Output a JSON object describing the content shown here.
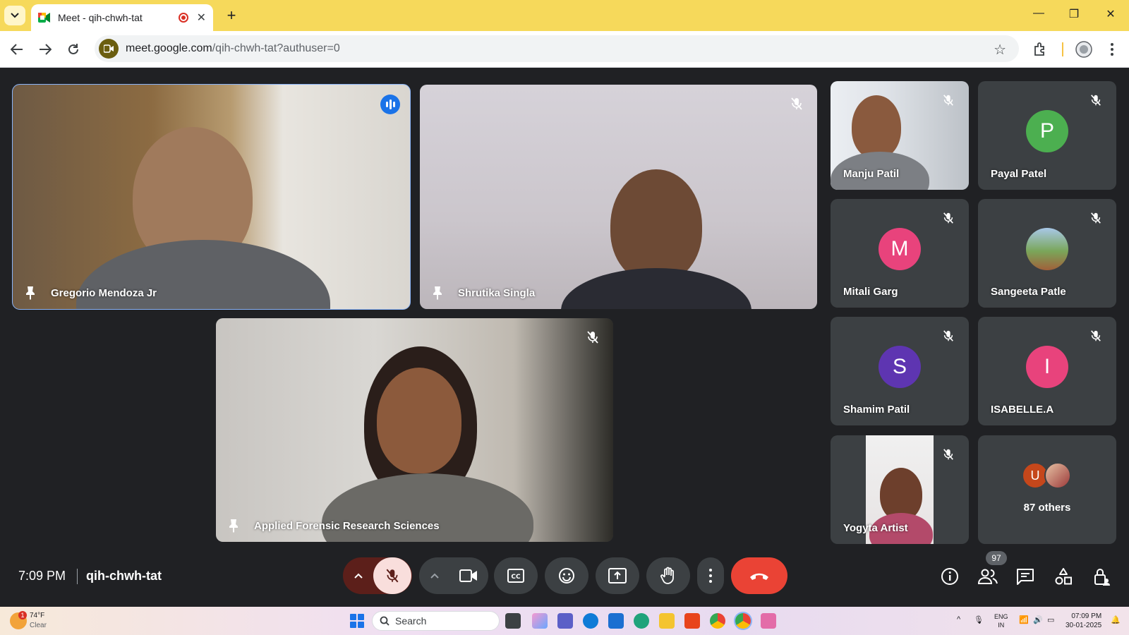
{
  "browser": {
    "tab_title": "Meet - qih-chwh-tat",
    "url_host": "meet.google.com",
    "url_path": "/qih-chwh-tat?authuser=0"
  },
  "tiles": {
    "t1": {
      "name": "Gregorio Mendoza Jr"
    },
    "t2": {
      "name": "Shrutika Singla"
    },
    "t3": {
      "name": "Applied Forensic Research Sciences"
    },
    "s1": {
      "name": "Manju Patil"
    },
    "s2": {
      "name": "Payal Patel",
      "initial": "P",
      "color": "#4caf50"
    },
    "s3": {
      "name": "Mitali Garg",
      "initial": "M",
      "color": "#e8437c"
    },
    "s4": {
      "name": "Sangeeta Patle"
    },
    "s5": {
      "name": "Shamim Patil",
      "initial": "S",
      "color": "#5e35b1"
    },
    "s6": {
      "name": "ISABELLE.A",
      "initial": "I",
      "color": "#e8437c"
    },
    "s7": {
      "name": "Yogyta Artist"
    },
    "others": {
      "initial": "U",
      "label": "87 others",
      "color": "#c5471b"
    }
  },
  "meeting": {
    "time": "7:09 PM",
    "code": "qih-chwh-tat",
    "participants_count": "97"
  },
  "taskbar": {
    "temp": "74°F",
    "condition": "Clear",
    "weather_badge": "1",
    "search": "Search",
    "lang1": "ENG",
    "lang2": "IN",
    "clock_time": "07:09 PM",
    "clock_date": "30-01-2025"
  },
  "colors": {
    "accent": "#8ab4f8",
    "end_call": "#ea4335",
    "mic_off_bg": "#f9dedc"
  }
}
